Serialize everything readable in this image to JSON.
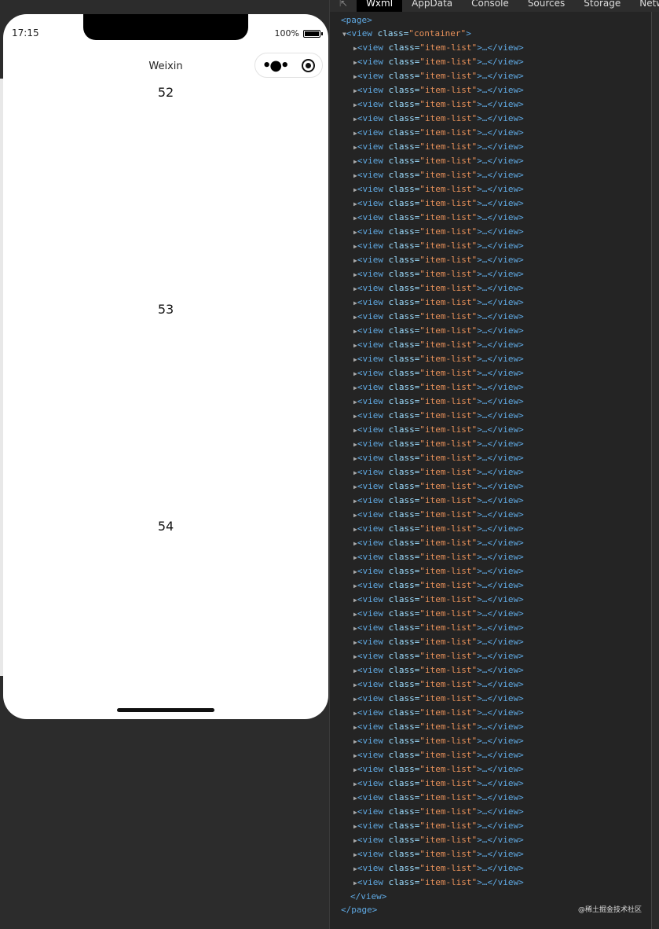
{
  "phone": {
    "time": "17:15",
    "battery": "100%",
    "nav_title": "Weixin",
    "items": [
      "52",
      "53",
      "54"
    ]
  },
  "devtools": {
    "tabs": [
      "Wxml",
      "AppData",
      "Console",
      "Sources",
      "Storage",
      "Network"
    ],
    "active_tab": "Wxml",
    "root_tag": "<page>",
    "root_close": "</page>",
    "container": {
      "tag": "view",
      "class": "container",
      "close": "</view>"
    },
    "child": {
      "tag": "view",
      "class": "item-list"
    },
    "child_count": 60
  },
  "watermark": "@稀土掘金技术社区"
}
